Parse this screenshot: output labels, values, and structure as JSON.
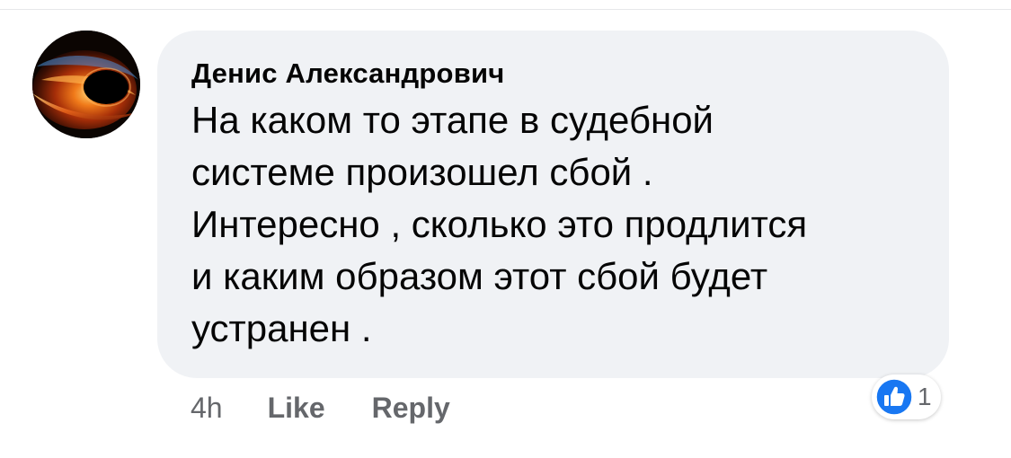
{
  "comment": {
    "author": "Денис Александрович",
    "lines": [
      "На каком то этапе в судебной",
      "системе произошел сбой .",
      "Интересно , сколько это продлится",
      "и каким образом этот сбой будет",
      "устранен ."
    ],
    "timestamp": "4h",
    "like_label": "Like",
    "reply_label": "Reply",
    "reactions": {
      "icon": "thumbs-up-icon",
      "count": "1",
      "color": "#1877f2"
    }
  },
  "colors": {
    "bubble": "#f0f2f5",
    "text": "#050505",
    "secondary": "#65676b",
    "accent": "#1877f2"
  }
}
